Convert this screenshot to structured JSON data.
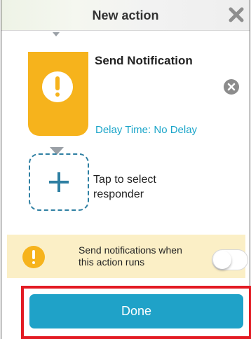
{
  "header": {
    "title": "New action",
    "close_icon": "close-icon"
  },
  "action": {
    "title": "Send Notification",
    "delay_link": "Delay Time: No Delay",
    "icon": "alert-icon",
    "remove_icon": "remove-icon",
    "tile_color": "#f6b31c"
  },
  "responder": {
    "label": "Tap to select responder",
    "icon": "plus-icon"
  },
  "notify": {
    "text": "Send notifications when this action runs",
    "icon": "alert-icon",
    "toggle_on": false,
    "banner_color": "#fbefc6"
  },
  "footer": {
    "done_label": "Done",
    "accent": "#1fa2c8",
    "highlight": "#e31b23"
  }
}
